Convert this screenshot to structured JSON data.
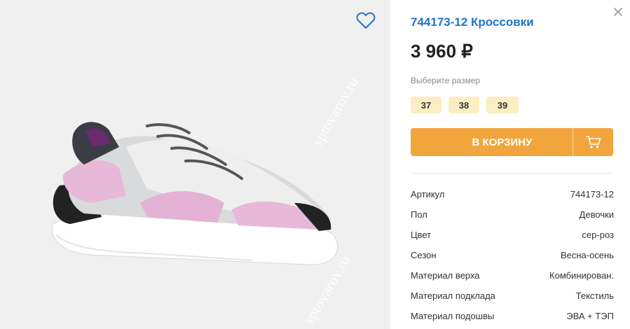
{
  "product": {
    "title": "744173-12 Кроссовки",
    "price": "3 960 ₽",
    "size_prompt": "Выберите размер",
    "sizes": [
      "37",
      "38",
      "39"
    ],
    "add_to_cart_label": "В КОРЗИНУ"
  },
  "watermark": {
    "text_1": "sptovarov.ru",
    "text_2": "sptovarov.ru"
  },
  "specs": [
    {
      "key": "Артикул",
      "value": "744173-12"
    },
    {
      "key": "Пол",
      "value": "Девочки"
    },
    {
      "key": "Цвет",
      "value": "сер-роз"
    },
    {
      "key": "Сезон",
      "value": "Весна-осень"
    },
    {
      "key": "Материал верха",
      "value": "Комбинирован."
    },
    {
      "key": "Материал подклада",
      "value": "Текстиль"
    },
    {
      "key": "Материал подошвы",
      "value": "ЭВА + ТЭП"
    }
  ],
  "icons": {
    "favorite": "heart-outline-icon",
    "close": "close-icon",
    "cart": "cart-icon"
  },
  "colors": {
    "title": "#1f74c8",
    "cart_button": "#f2a53d",
    "size_chip": "#fbeec2",
    "image_bg": "#f0f0f1"
  }
}
